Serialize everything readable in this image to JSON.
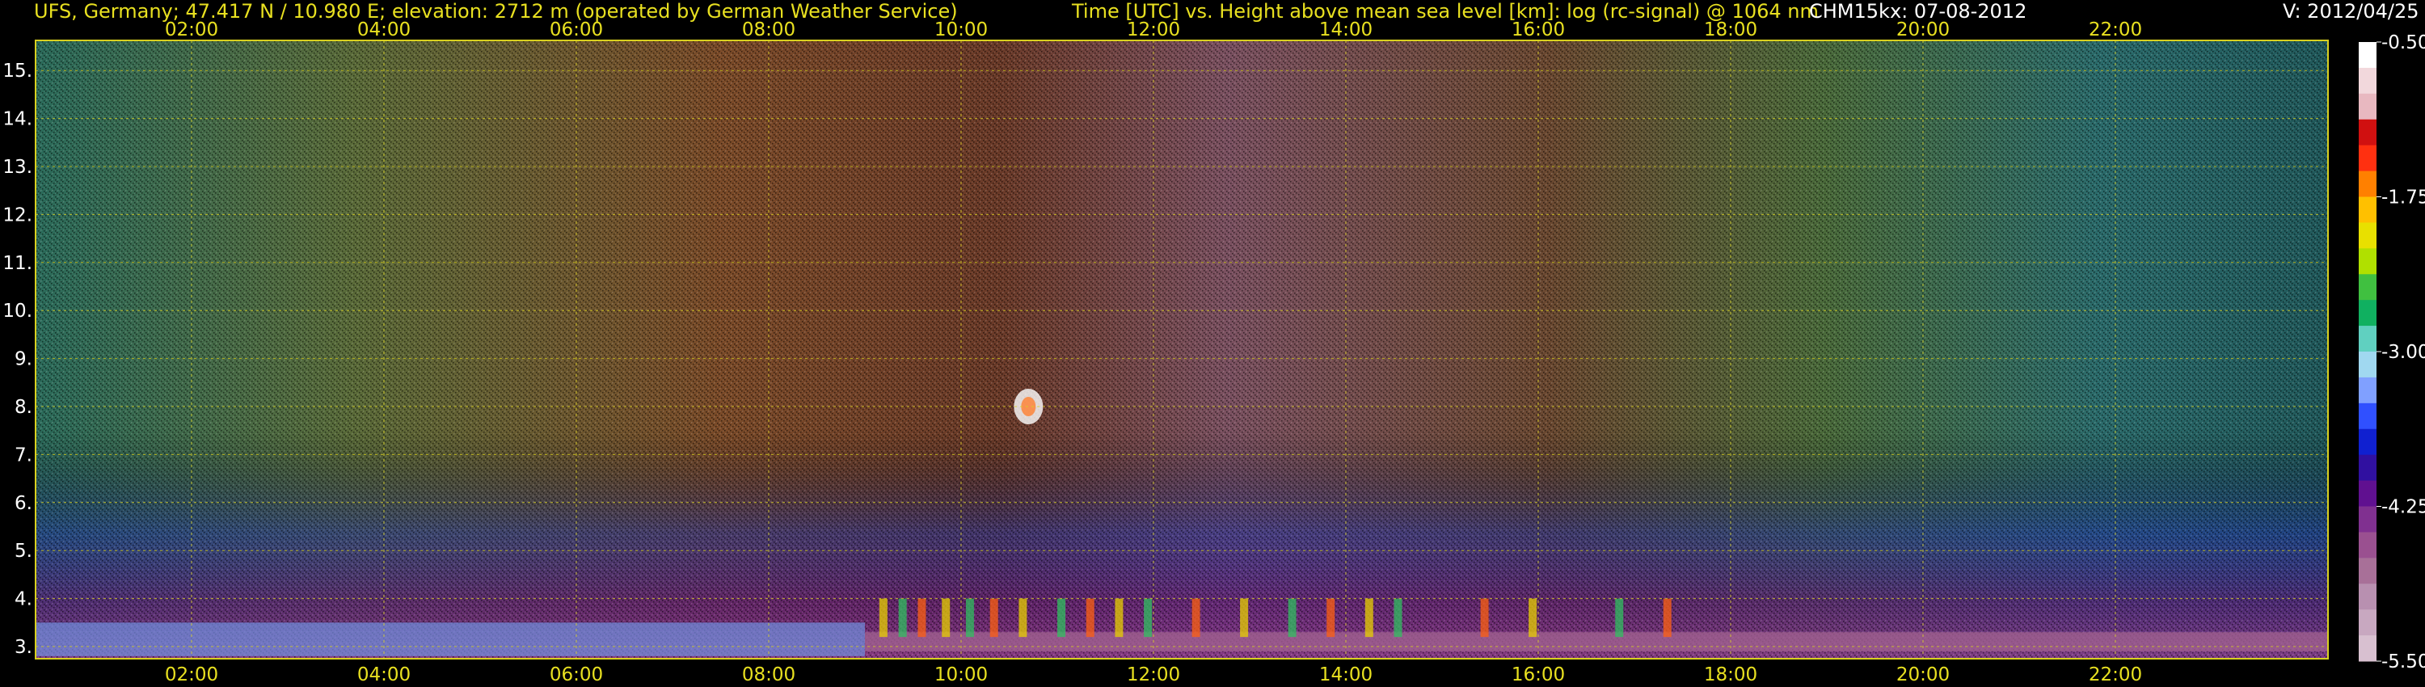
{
  "header": {
    "station": "UFS, Germany; 47.417 N / 10.980 E; elevation: 2712 m  (operated by German Weather Service)",
    "title": "Time [UTC] vs. Height above mean sea level [km]: log (rc-signal) @ 1064 nm",
    "instrument": "CHM15kx: 07-08-2012",
    "version": "V: 2012/04/25"
  },
  "chart_data": {
    "type": "heatmap",
    "title": "Time [UTC] vs. Height above mean sea level [km]: log (rc-signal) @ 1064 nm",
    "xlabel": "Time [UTC]",
    "ylabel": "Height above mean sea level [km]",
    "xlim": [
      0,
      24
    ],
    "ylim": [
      2.8,
      15.8
    ],
    "x_ticks": [
      2,
      4,
      6,
      8,
      10,
      12,
      14,
      16,
      18,
      20,
      22
    ],
    "x_tick_labels": [
      "02:00",
      "04:00",
      "06:00",
      "08:00",
      "10:00",
      "12:00",
      "14:00",
      "16:00",
      "18:00",
      "20:00",
      "22:00"
    ],
    "y_ticks": [
      3,
      4,
      5,
      6,
      7,
      8,
      9,
      10,
      11,
      12,
      13,
      14,
      15
    ],
    "y_tick_labels": [
      "3.",
      "4.",
      "5.",
      "6.",
      "7.",
      "8.",
      "9.",
      "10.",
      "11.",
      "12.",
      "13.",
      "14.",
      "15."
    ],
    "grid": true,
    "colorbar": {
      "range": [
        -5.5,
        -0.5
      ],
      "ticks": [
        -0.5,
        -1.75,
        -3.0,
        -4.25,
        -5.5
      ],
      "tick_labels": [
        "-0.50",
        "-1.75",
        "-3.00",
        "-4.25",
        "-5.50"
      ],
      "colors": [
        "#ffffff",
        "#f2d8dc",
        "#e8b8c0",
        "#d01010",
        "#ff3010",
        "#ff8000",
        "#ffc000",
        "#e8e000",
        "#b0e000",
        "#40c040",
        "#10b060",
        "#60d0c0",
        "#a0d8f0",
        "#80a0ff",
        "#3050ff",
        "#1020d0",
        "#3010a0",
        "#601090",
        "#803090",
        "#9a5090",
        "#a87098",
        "#b890b0",
        "#c8a8c0",
        "#d8c0d0"
      ]
    }
  }
}
